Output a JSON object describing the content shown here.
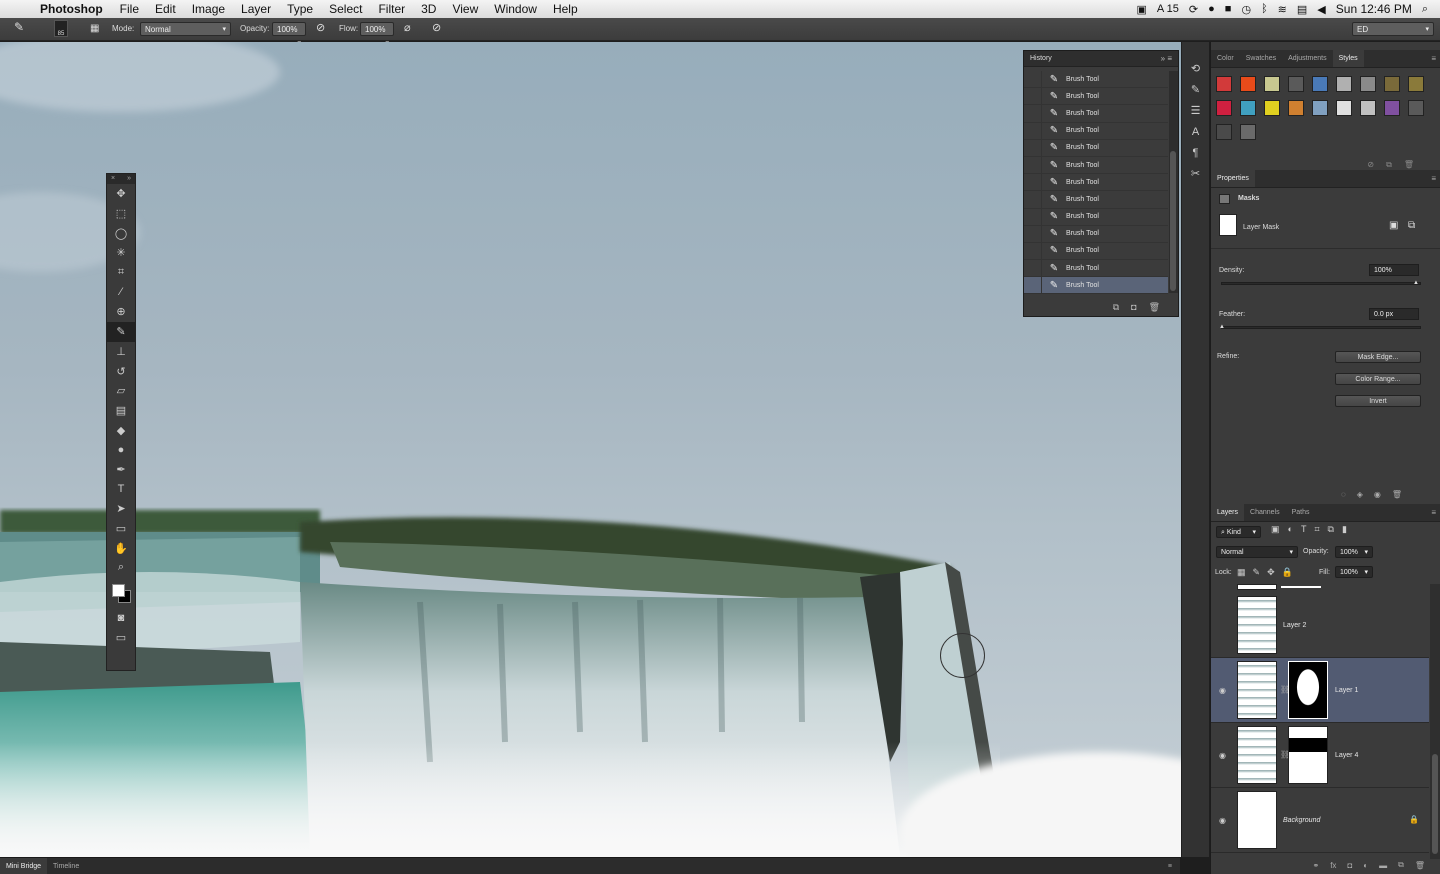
{
  "menubar": {
    "app_name": "Photoshop",
    "menus": [
      "File",
      "Edit",
      "Image",
      "Layer",
      "Type",
      "Select",
      "Filter",
      "3D",
      "View",
      "Window",
      "Help"
    ],
    "status_badge": "15",
    "clock": "Sun 12:46 PM"
  },
  "options": {
    "brush_size": "85",
    "mode_label": "Mode:",
    "mode_value": "Normal",
    "opacity_label": "Opacity:",
    "opacity_value": "100%",
    "flow_label": "Flow:",
    "flow_value": "100%",
    "workspace": "ED"
  },
  "history": {
    "title": "History",
    "items": [
      "Brush Tool",
      "Brush Tool",
      "Brush Tool",
      "Brush Tool",
      "Brush Tool",
      "Brush Tool",
      "Brush Tool",
      "Brush Tool",
      "Brush Tool",
      "Brush Tool",
      "Brush Tool",
      "Brush Tool",
      "Brush Tool"
    ]
  },
  "styles_panel": {
    "tabs": [
      "Color",
      "Swatches",
      "Adjustments",
      "Styles"
    ],
    "swatch_colors": [
      "#d23a3a",
      "#e84b1a",
      "#c8c890",
      "#5a5a5a",
      "#4a7ab8",
      "#b0b0b0",
      "#8a8a8a",
      "#7a6a3a",
      "#8a7a3a",
      "#d02040",
      "#40a0c0",
      "#e0d020",
      "#d08030",
      "#80a0c0",
      "#e0e0e0",
      "#c0c0c0",
      "#8050a0",
      "#5a5a5a",
      "#4a4a4a",
      "#6a6a6a"
    ]
  },
  "properties": {
    "title": "Properties",
    "section": "Masks",
    "mask_type": "Layer Mask",
    "density_label": "Density:",
    "density_value": "100%",
    "feather_label": "Feather:",
    "feather_value": "0.0 px",
    "refine_label": "Refine:",
    "btn_mask_edge": "Mask Edge...",
    "btn_color_range": "Color Range...",
    "btn_invert": "Invert"
  },
  "layers": {
    "tabs": [
      "Layers",
      "Channels",
      "Paths"
    ],
    "kind_label": "Kind",
    "blend_mode": "Normal",
    "opacity_label": "Opacity:",
    "opacity_value": "100%",
    "lock_label": "Lock:",
    "fill_label": "Fill:",
    "fill_value": "100%",
    "items": [
      {
        "name": "Layer 2",
        "visible": false,
        "selected": false
      },
      {
        "name": "Layer 1",
        "visible": true,
        "selected": true
      },
      {
        "name": "Layer 4",
        "visible": true,
        "selected": false
      },
      {
        "name": "Background",
        "visible": true,
        "selected": false
      }
    ]
  },
  "bottom_tabs": [
    "Mini Bridge",
    "Timeline"
  ],
  "icons": {
    "apple": "apple-icon",
    "brush": "brush-icon",
    "eye": "eye-icon",
    "lock": "lock-icon",
    "trash": "trash-icon",
    "camera": "camera-icon"
  }
}
